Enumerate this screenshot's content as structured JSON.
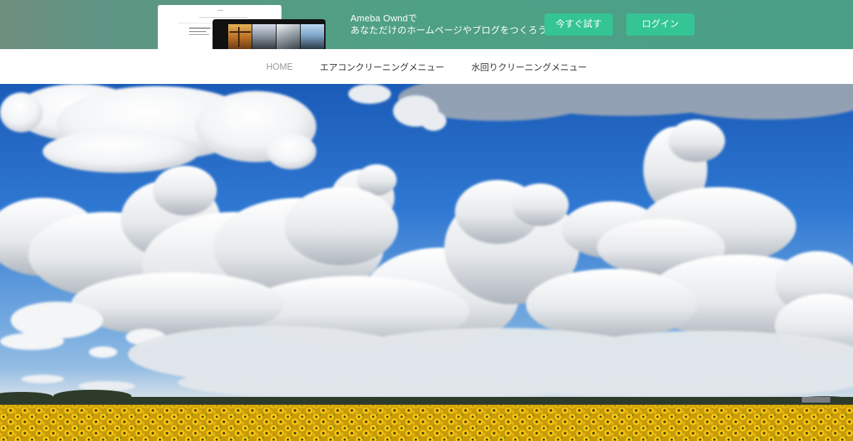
{
  "promo": {
    "line1": "Ameba Owndで",
    "line2": "あなただけのホームページやブログをつくろう",
    "try_label": "今すぐ試す",
    "login_label": "ログイン"
  },
  "nav": {
    "items": [
      {
        "label": "HOME"
      },
      {
        "label": "エアコンクリーニングメニュー"
      },
      {
        "label": "水回りクリーニングメニュー"
      }
    ]
  },
  "colors": {
    "banner_bg": "#4fa085",
    "button_bg": "#35c594",
    "sky": "#2b72cc",
    "sunflower": "#f3c70f"
  }
}
